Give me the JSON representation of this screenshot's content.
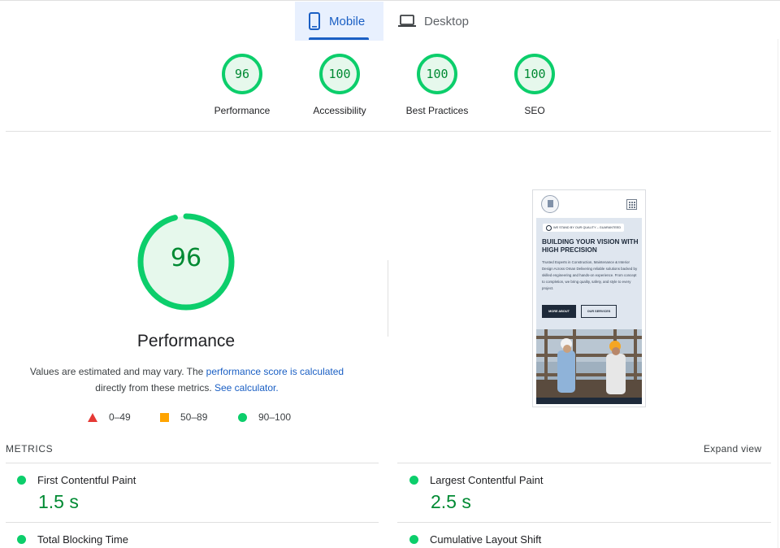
{
  "tabs": [
    {
      "label": "Mobile",
      "icon": "smartphone-icon",
      "selected": true
    },
    {
      "label": "Desktop",
      "icon": "laptop-icon",
      "selected": false
    }
  ],
  "categories": [
    {
      "score": "96",
      "label": "Performance"
    },
    {
      "score": "100",
      "label": "Accessibility"
    },
    {
      "score": "100",
      "label": "Best Practices"
    },
    {
      "score": "100",
      "label": "SEO"
    }
  ],
  "performance": {
    "score": "96",
    "score_fraction": 0.96,
    "title": "Performance",
    "note_prefix": "Values are estimated and may vary. The ",
    "note_link": "performance score is calculated",
    "note_middle": " directly from these metrics. ",
    "note_link2": "See calculator.",
    "legend": {
      "fail": "0–49",
      "average": "50–89",
      "pass": "90–100"
    }
  },
  "colors": {
    "pass": "#0cce6b",
    "pass_text": "#008a33",
    "average": "#ffa400",
    "fail": "#e53935",
    "accent": "#1a5fc4"
  },
  "thumbnail": {
    "badge": "WE STAND BY OUR QUALITY – GUARANTEED",
    "headline": "BUILDING YOUR VISION WITH HIGH PRECISION",
    "paragraph": "Trusted Experts in Construction, Maintenance & Interior Design Across Oman Delivering reliable solutions backed by skilled engineering and hands-on experience. From concept to completion, we bring quality, safety, and style to every project.",
    "button_primary": "MORE ABOUT",
    "button_secondary": "OUR SERVICES"
  },
  "metrics": {
    "title": "METRICS",
    "expand_label": "Expand view",
    "items": [
      {
        "name": "First Contentful Paint",
        "value": "1.5 s"
      },
      {
        "name": "Largest Contentful Paint",
        "value": "2.5 s"
      },
      {
        "name": "Total Blocking Time",
        "value": ""
      },
      {
        "name": "Cumulative Layout Shift",
        "value": ""
      }
    ]
  }
}
